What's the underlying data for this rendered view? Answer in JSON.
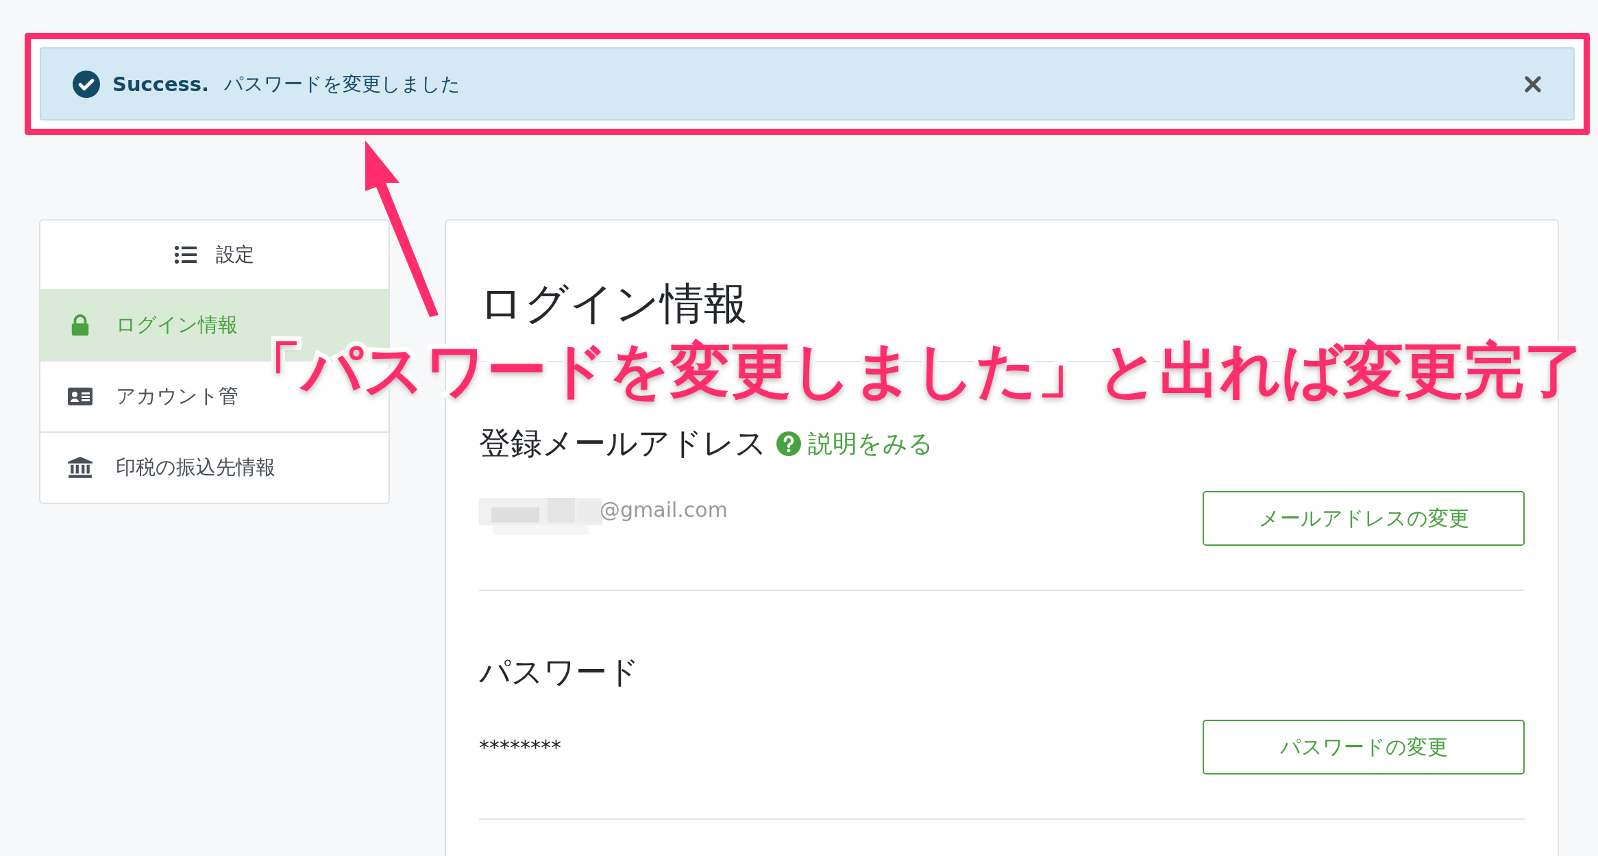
{
  "alert": {
    "title": "Success.",
    "message": "パスワードを変更しました"
  },
  "sidebar": {
    "header": "設定",
    "items": [
      {
        "label": "ログイン情報",
        "selected": true
      },
      {
        "label": "アカウント管",
        "selected": false
      },
      {
        "label": "印税の振込先情報",
        "selected": false
      }
    ]
  },
  "main": {
    "title": "ログイン情報",
    "sections": [
      {
        "heading": "登録メールアドレス",
        "help_link": "説明をみる",
        "value": "@gmail.com",
        "redacted": true,
        "button": "メールアドレスの変更"
      },
      {
        "heading": "パスワード",
        "value": "********",
        "redacted": false,
        "button": "パスワードの変更"
      }
    ]
  },
  "annotation": {
    "text": "「パスワードを変更しました」と出れば変更完了"
  }
}
